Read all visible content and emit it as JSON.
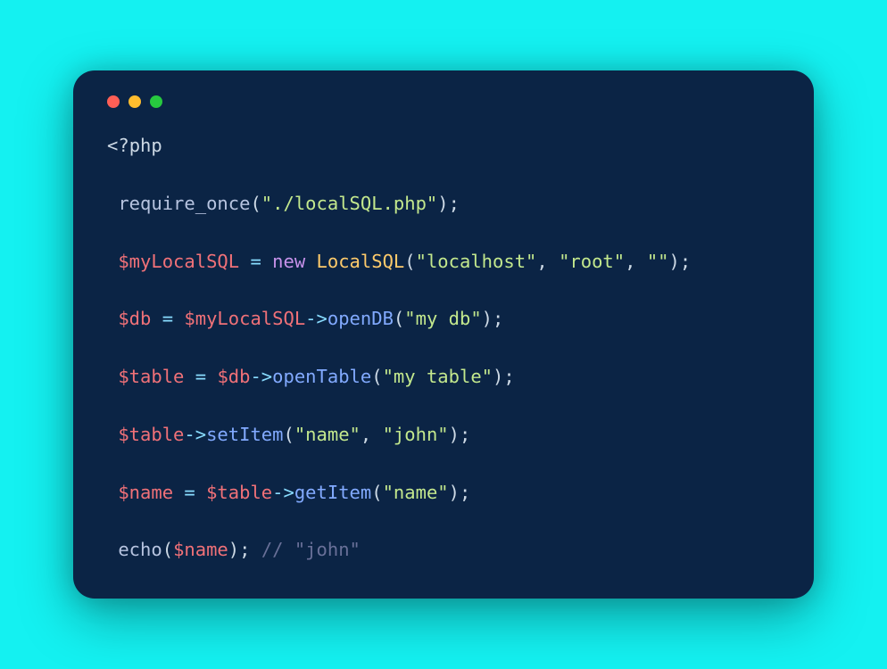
{
  "code": {
    "open_tag_lt": "<",
    "open_tag_q": "?",
    "open_tag_php": "php",
    "line_require": {
      "require": "require_once",
      "arg": "\"./localSQL.php\""
    },
    "line_new": {
      "var": "$myLocalSQL",
      "eq": "=",
      "new": "new",
      "class": "LocalSQL",
      "arg1": "\"localhost\"",
      "comma1": ",",
      "arg2": "\"root\"",
      "comma2": ",",
      "arg3": "\"\""
    },
    "line_db": {
      "var": "$db",
      "eq": "=",
      "obj": "$myLocalSQL",
      "arrow": "->",
      "method": "openDB",
      "arg": "\"my db\""
    },
    "line_table": {
      "var": "$table",
      "eq": "=",
      "obj": "$db",
      "arrow": "->",
      "method": "openTable",
      "arg": "\"my table\""
    },
    "line_setitem": {
      "obj": "$table",
      "arrow": "->",
      "method": "setItem",
      "arg1": "\"name\"",
      "comma": ",",
      "arg2": "\"john\""
    },
    "line_name": {
      "var": "$name",
      "eq": "=",
      "obj": "$table",
      "arrow": "->",
      "method": "getItem",
      "arg": "\"name\""
    },
    "line_echo": {
      "echo": "echo",
      "arg": "$name",
      "comment": "// \"john\""
    },
    "paren_open": "(",
    "paren_close": ")",
    "semi": ";",
    "space": " "
  }
}
